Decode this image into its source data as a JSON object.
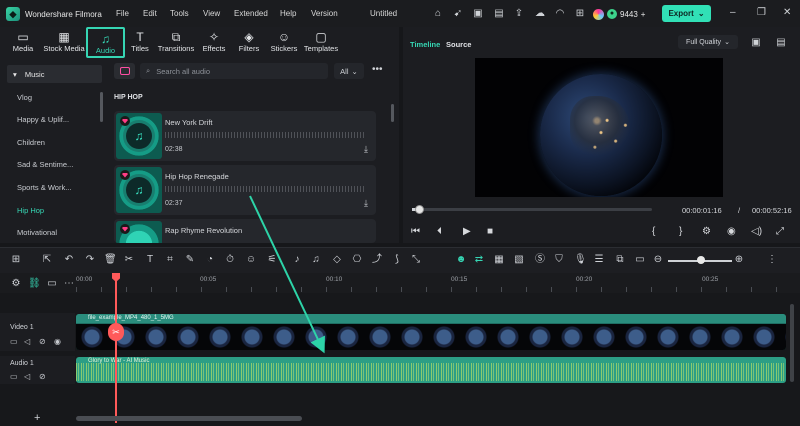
{
  "app": {
    "name": "Wondershare Filmora",
    "menu": [
      "File",
      "Edit",
      "Tools",
      "View",
      "Extended",
      "Help",
      "Version"
    ],
    "project_title": "Untitled",
    "credits": "9443",
    "export_label": "Export"
  },
  "media_tabs": [
    {
      "label": "Media",
      "icon": "media-icon"
    },
    {
      "label": "Stock Media",
      "icon": "stock-media-icon"
    },
    {
      "label": "Audio",
      "icon": "music-note-icon",
      "active": true
    },
    {
      "label": "Titles",
      "icon": "titles-icon"
    },
    {
      "label": "Transitions",
      "icon": "transitions-icon"
    },
    {
      "label": "Effects",
      "icon": "effects-icon"
    },
    {
      "label": "Filters",
      "icon": "filters-icon"
    },
    {
      "label": "Stickers",
      "icon": "stickers-icon"
    },
    {
      "label": "Templates",
      "icon": "templates-icon"
    }
  ],
  "sidebar": {
    "header": "Music",
    "items": [
      "Vlog",
      "Happy & Uplif...",
      "Children",
      "Sad & Sentime...",
      "Sports & Work...",
      "Hip Hop",
      "Motivational"
    ],
    "active": "Hip Hop"
  },
  "search": {
    "placeholder": "Search all audio",
    "filter": "All"
  },
  "section_label": "HIP HOP",
  "tracks": [
    {
      "name": "New York Drift",
      "duration": "02:38"
    },
    {
      "name": "Hip Hop Renegade",
      "duration": "02:37"
    },
    {
      "name": "Rap Rhyme Revolution",
      "duration": ""
    }
  ],
  "preview": {
    "tabs": [
      "Timeline",
      "Source"
    ],
    "quality": "Full Quality",
    "current_time": "00:00:01:16",
    "separator": "/",
    "total_time": "00:00:52:16",
    "progress_fraction": 0.03
  },
  "timeline": {
    "ruler_labels": [
      "00:00",
      "00:05",
      "00:10",
      "00:15",
      "00:20",
      "00:25"
    ],
    "tracks": [
      {
        "label": "Video 1",
        "clip_name": "file_example_MP4_480_1_5MG"
      },
      {
        "label": "Audio 1",
        "clip_name": "Glory to War - AI Music"
      }
    ]
  },
  "colors": {
    "accent": "#36d6b4",
    "playhead": "#ff5a5a",
    "video_clip": "#1f6e63",
    "audio_clip": "#2c9e85"
  }
}
